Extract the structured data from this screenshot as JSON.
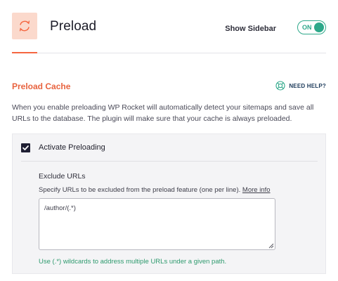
{
  "header": {
    "icon": "refresh-icon",
    "title": "Preload",
    "sidebar_label": "Show Sidebar",
    "sidebar_toggle_state": "ON"
  },
  "section": {
    "title": "Preload Cache",
    "help_icon": "lifebuoy-icon",
    "help_label": "NEED HELP?",
    "description": "When you enable preloading WP Rocket will automatically detect your sitemaps and save all URLs to the database. The plugin will make sure that your cache is always preloaded."
  },
  "panel": {
    "activate_label": "Activate Preloading",
    "activate_checked": true,
    "exclude": {
      "title": "Exclude URLs",
      "help_text": "Specify URLs to be excluded from the preload feature (one per line).",
      "more_info_label": "More info",
      "value": "/author/(.*)",
      "note": "Use (.*) wildcards to address multiple URLs under a given path."
    }
  },
  "colors": {
    "accent": "#f56640",
    "accent_soft": "#fbd9cc",
    "toggle": "#2ea88a",
    "note": "#2e9a6e",
    "help_text": "#1c3a5a"
  }
}
